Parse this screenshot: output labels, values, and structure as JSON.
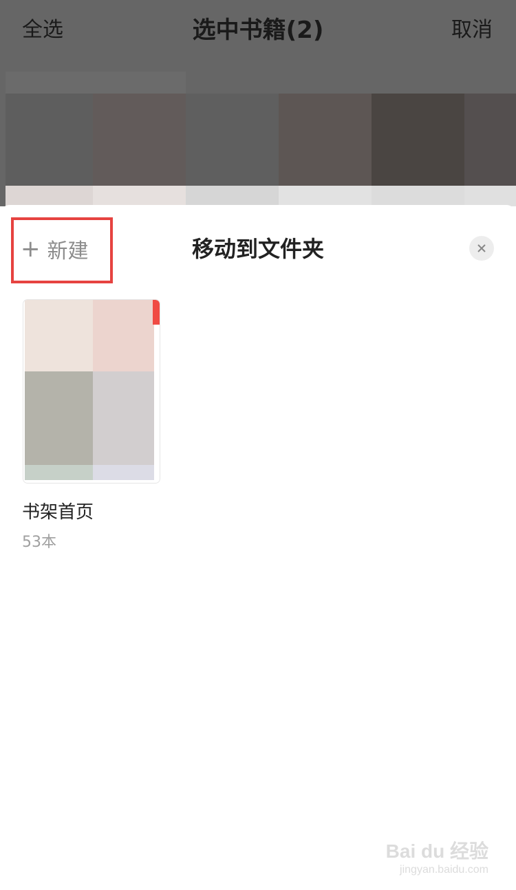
{
  "topbar": {
    "select_all": "全选",
    "title": "选中书籍(2)",
    "cancel": "取消"
  },
  "sheet": {
    "new_label": "新建",
    "title": "移动到文件夹",
    "close_icon": "close-icon"
  },
  "folders": [
    {
      "name": "书架首页",
      "count": "53本"
    }
  ],
  "watermark": {
    "line1": "Bai du 经验",
    "line2": "jingyan.baidu.com"
  },
  "colors": {
    "highlight": "#e64340",
    "badge": "#f04b44"
  }
}
